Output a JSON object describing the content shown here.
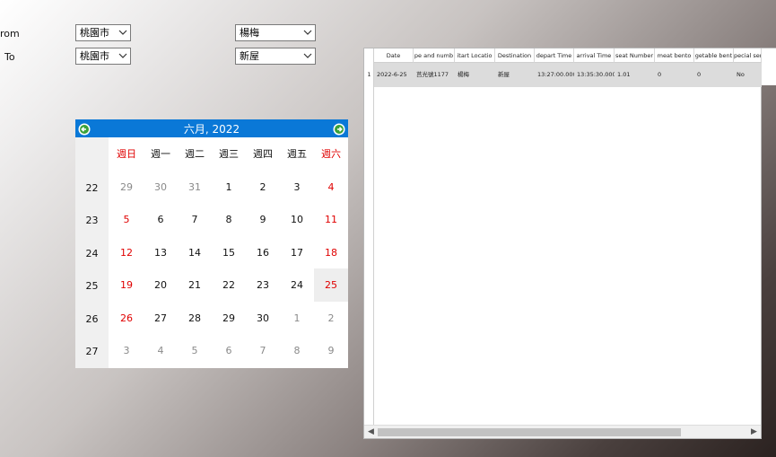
{
  "form": {
    "from_label": "rom",
    "to_label": "To",
    "from_city": "桃園市",
    "from_station": "楊梅",
    "to_city": "桃園市",
    "to_station": "新屋"
  },
  "calendar": {
    "title": "六月, 2022",
    "weekdays": [
      "週日",
      "週一",
      "週二",
      "週三",
      "週四",
      "週五",
      "週六"
    ],
    "week_numbers": [
      "22",
      "23",
      "24",
      "25",
      "26",
      "27"
    ],
    "days": [
      [
        "29",
        "30",
        "31",
        "1",
        "2",
        "3",
        "4"
      ],
      [
        "5",
        "6",
        "7",
        "8",
        "9",
        "10",
        "11"
      ],
      [
        "12",
        "13",
        "14",
        "15",
        "16",
        "17",
        "18"
      ],
      [
        "19",
        "20",
        "21",
        "22",
        "23",
        "24",
        "25"
      ],
      [
        "26",
        "27",
        "28",
        "29",
        "30",
        "1",
        "2"
      ],
      [
        "3",
        "4",
        "5",
        "6",
        "7",
        "8",
        "9"
      ]
    ],
    "today": "25",
    "accent_color": "#0a78d7"
  },
  "grid": {
    "columns": [
      "Date",
      "pe and numb",
      "itart Locatio",
      "Destination",
      "depart Time",
      "arrival Time",
      "seat Number",
      "meat bento",
      "getable bent",
      "pecial serv"
    ],
    "rows": [
      {
        "num": "1",
        "cells": [
          "2022-6-25",
          "莒光號1177",
          "楊梅",
          "新屋",
          "13:27:00.000",
          "13:35:30.000",
          "1.01",
          "0",
          "0",
          "No"
        ]
      }
    ]
  }
}
